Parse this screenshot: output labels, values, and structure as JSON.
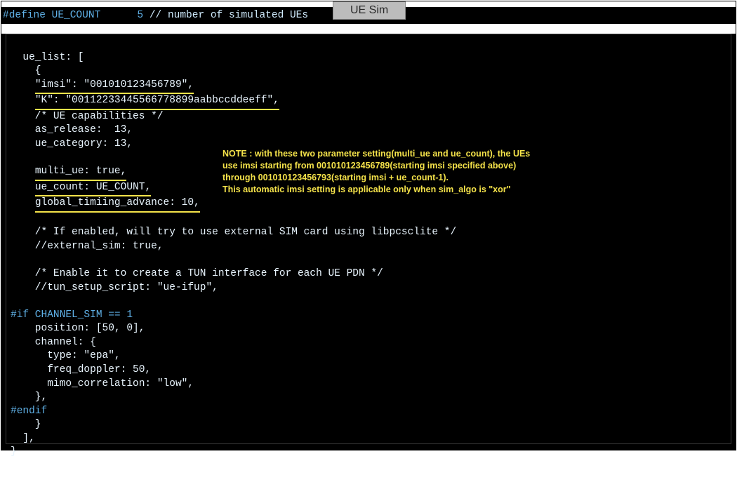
{
  "tab": {
    "label": "UE Sim"
  },
  "define": {
    "prefix": "#define UE_COUNT      5 ",
    "comment": "// number of simulated UEs"
  },
  "code": {
    "l01": "  ue_list: [",
    "l02": "    {",
    "l03a": "    ",
    "l03b": "\"imsi\": \"001010123456789\",",
    "l04a": "    ",
    "l04b": "\"K\": \"00112233445566778899aabbccddeeff\",",
    "l05": "    /* UE capabilities */",
    "l06": "    as_release:  13,",
    "l07": "    ue_category: 13,",
    "l08": "",
    "l09a": "    ",
    "l09b": "multi_ue: true,",
    "l10a": "    ",
    "l10b": "ue_count: UE_COUNT,",
    "l11a": "    ",
    "l11b": "global_timiing_advance: 10,",
    "l12": "",
    "l13": "    /* If enabled, will try to use external SIM card using libpcsclite */",
    "l14": "    //external_sim: true,",
    "l15": "",
    "l16": "    /* Enable it to create a TUN interface for each UE PDN */",
    "l17": "    //tun_setup_script: \"ue-ifup\",",
    "l18": "",
    "l19": "#if CHANNEL_SIM == 1",
    "l20": "    position: [50, 0],",
    "l21": "    channel: {",
    "l22": "      type: \"epa\",",
    "l23": "      freq_doppler: 50,",
    "l24": "      mimo_correlation: \"low\",",
    "l25": "    },",
    "l26": "#endif",
    "l27": "    }",
    "l28": "  ],",
    "l29": "}"
  },
  "note": {
    "label": "NOTE",
    "line1": " : with these two parameter setting(multi_ue and ue_count), the UEs",
    "line2": "use imsi starting from 001010123456789(starting imsi specified above)",
    "line3": "through 001010123456793(starting imsi + ue_count-1).",
    "line4": "This automatic imsi setting is applicable only when sim_algo is \"xor\""
  }
}
